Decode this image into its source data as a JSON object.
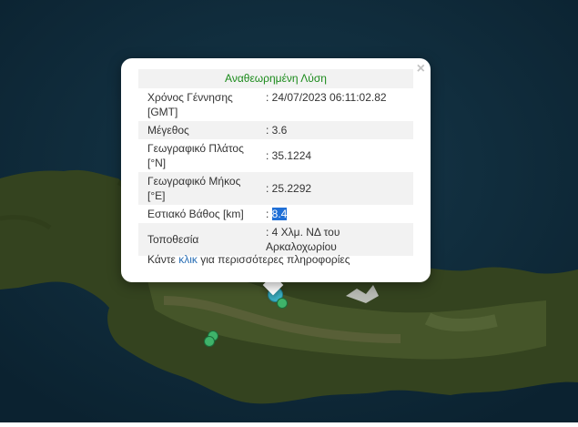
{
  "popup": {
    "heading": "Αναθεωρημένη Λύση",
    "close_symbol": "×",
    "rows": [
      {
        "label": "Χρόνος Γέννησης [GMT]",
        "value": ": 24/07/2023 06:11:02.82"
      },
      {
        "label": "Μέγεθος",
        "value": ": 3.6"
      },
      {
        "label": "Γεωγραφικό Πλάτος [°N]",
        "value": ": 35.1224"
      },
      {
        "label": "Γεωγραφικό Μήκος [°E]",
        "value": ": 25.2292"
      },
      {
        "label": "Εστιακό Βάθος [km]",
        "value_prefix": ": ",
        "value_selected": "8.4"
      },
      {
        "label": "Τοποθεσία",
        "value": ": 4 Χλμ. ΝΔ του Αρκαλοχωρίου"
      }
    ],
    "more": {
      "before": "Κάντε ",
      "link": "κλικ",
      "after": " για περισσότερες πληροφορίες"
    }
  },
  "colors": {
    "sea": "#0f2d3a",
    "land": "#3a4a26",
    "marker_selected": "#3cb4c8",
    "marker_other": "#3fb36a",
    "heading": "#1a8a1a",
    "link": "#2a6fb5",
    "selection": "#1f6fd6"
  },
  "map": {
    "region": "Crete",
    "base_layer": "satellite"
  }
}
